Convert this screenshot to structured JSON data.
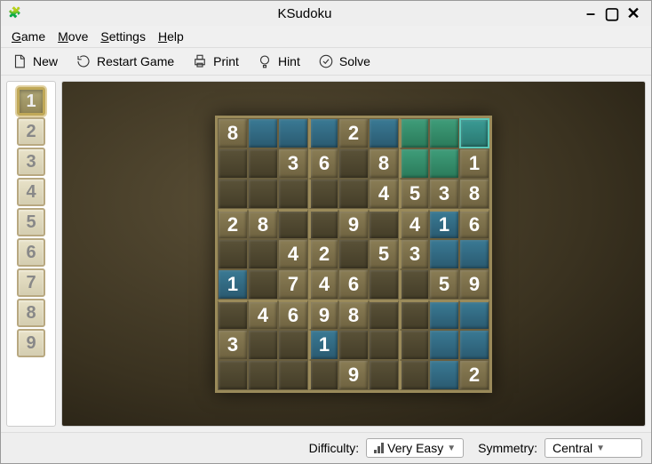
{
  "window": {
    "title": "KSudoku"
  },
  "menubar": {
    "game": "Game",
    "move": "Move",
    "settings": "Settings",
    "help": "Help"
  },
  "toolbar": {
    "new": "New",
    "restart": "Restart Game",
    "print": "Print",
    "hint": "Hint",
    "solve": "Solve"
  },
  "palette": {
    "selected": 1,
    "items": [
      "1",
      "2",
      "3",
      "4",
      "5",
      "6",
      "7",
      "8",
      "9"
    ]
  },
  "colors": {
    "board_bg": "#3a3220",
    "given_cell": "#8a7d55",
    "empty_cell": "#5a5238",
    "highlight_blue": "#3a7a94",
    "highlight_green": "#3f9d7a",
    "cursor_teal": "#3a9a94"
  },
  "board": {
    "rows": [
      [
        {
          "v": "8",
          "c": "given"
        },
        {
          "v": "",
          "c": "blue"
        },
        {
          "v": "",
          "c": "blue"
        },
        {
          "v": "",
          "c": "blue"
        },
        {
          "v": "2",
          "c": "given"
        },
        {
          "v": "",
          "c": "blue"
        },
        {
          "v": "",
          "c": "green"
        },
        {
          "v": "",
          "c": "green"
        },
        {
          "v": "",
          "c": "teal"
        }
      ],
      [
        {
          "v": "",
          "c": "empty"
        },
        {
          "v": "",
          "c": "empty"
        },
        {
          "v": "3",
          "c": "given"
        },
        {
          "v": "6",
          "c": "given"
        },
        {
          "v": "",
          "c": "empty"
        },
        {
          "v": "8",
          "c": "given"
        },
        {
          "v": "",
          "c": "green"
        },
        {
          "v": "",
          "c": "green"
        },
        {
          "v": "1",
          "c": "given"
        }
      ],
      [
        {
          "v": "",
          "c": "empty"
        },
        {
          "v": "",
          "c": "empty"
        },
        {
          "v": "",
          "c": "empty"
        },
        {
          "v": "",
          "c": "empty"
        },
        {
          "v": "",
          "c": "empty"
        },
        {
          "v": "4",
          "c": "given"
        },
        {
          "v": "5",
          "c": "given"
        },
        {
          "v": "3",
          "c": "given"
        },
        {
          "v": "8",
          "c": "given"
        }
      ],
      [
        {
          "v": "2",
          "c": "given"
        },
        {
          "v": "8",
          "c": "given"
        },
        {
          "v": "",
          "c": "empty"
        },
        {
          "v": "",
          "c": "empty"
        },
        {
          "v": "9",
          "c": "given"
        },
        {
          "v": "",
          "c": "empty"
        },
        {
          "v": "4",
          "c": "given"
        },
        {
          "v": "1",
          "c": "blue"
        },
        {
          "v": "6",
          "c": "given"
        }
      ],
      [
        {
          "v": "",
          "c": "empty"
        },
        {
          "v": "",
          "c": "empty"
        },
        {
          "v": "4",
          "c": "given"
        },
        {
          "v": "2",
          "c": "given"
        },
        {
          "v": "",
          "c": "empty"
        },
        {
          "v": "5",
          "c": "given"
        },
        {
          "v": "3",
          "c": "given"
        },
        {
          "v": "",
          "c": "blue"
        },
        {
          "v": "",
          "c": "blue"
        }
      ],
      [
        {
          "v": "1",
          "c": "blue"
        },
        {
          "v": "",
          "c": "empty"
        },
        {
          "v": "7",
          "c": "given"
        },
        {
          "v": "4",
          "c": "given"
        },
        {
          "v": "6",
          "c": "given"
        },
        {
          "v": "",
          "c": "empty"
        },
        {
          "v": "",
          "c": "empty"
        },
        {
          "v": "5",
          "c": "given"
        },
        {
          "v": "9",
          "c": "given"
        }
      ],
      [
        {
          "v": "",
          "c": "empty"
        },
        {
          "v": "4",
          "c": "given"
        },
        {
          "v": "6",
          "c": "given"
        },
        {
          "v": "9",
          "c": "given"
        },
        {
          "v": "8",
          "c": "given"
        },
        {
          "v": "",
          "c": "empty"
        },
        {
          "v": "",
          "c": "empty"
        },
        {
          "v": "",
          "c": "blue"
        },
        {
          "v": "",
          "c": "blue"
        }
      ],
      [
        {
          "v": "3",
          "c": "given"
        },
        {
          "v": "",
          "c": "empty"
        },
        {
          "v": "",
          "c": "empty"
        },
        {
          "v": "1",
          "c": "blue"
        },
        {
          "v": "",
          "c": "empty"
        },
        {
          "v": "",
          "c": "empty"
        },
        {
          "v": "",
          "c": "empty"
        },
        {
          "v": "",
          "c": "blue"
        },
        {
          "v": "",
          "c": "blue"
        }
      ],
      [
        {
          "v": "",
          "c": "empty"
        },
        {
          "v": "",
          "c": "empty"
        },
        {
          "v": "",
          "c": "empty"
        },
        {
          "v": "",
          "c": "empty"
        },
        {
          "v": "9",
          "c": "given"
        },
        {
          "v": "",
          "c": "empty"
        },
        {
          "v": "",
          "c": "empty"
        },
        {
          "v": "",
          "c": "blue"
        },
        {
          "v": "2",
          "c": "given"
        }
      ]
    ]
  },
  "status": {
    "difficulty_label": "Difficulty:",
    "difficulty_value": "Very Easy",
    "symmetry_label": "Symmetry:",
    "symmetry_value": "Central"
  }
}
